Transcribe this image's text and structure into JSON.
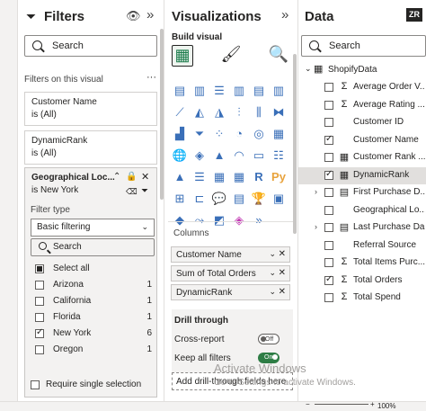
{
  "filters": {
    "title": "Filters",
    "search_placeholder": "Search",
    "section_label": "Filters on this visual",
    "cards": [
      {
        "name": "Customer Name",
        "value": "is (All)"
      },
      {
        "name": "DynamicRank",
        "value": "is (All)"
      }
    ],
    "active_card": {
      "name": "Geographical Loc...",
      "value": "is New York",
      "filter_type_label": "Filter type",
      "filter_type": "Basic filtering",
      "search_placeholder": "Search"
    },
    "items": [
      {
        "label": "Select all",
        "count": "",
        "state": "partial"
      },
      {
        "label": "Arizona",
        "count": "1",
        "state": "off"
      },
      {
        "label": "California",
        "count": "1",
        "state": "off"
      },
      {
        "label": "Florida",
        "count": "1",
        "state": "off"
      },
      {
        "label": "New York",
        "count": "6",
        "state": "on"
      },
      {
        "label": "Oregon",
        "count": "1",
        "state": "off"
      }
    ],
    "require_single": "Require single selection"
  },
  "viz": {
    "title": "Visualizations",
    "tab": "Build visual",
    "columns_label": "Columns",
    "wells": [
      "Customer Name",
      "Sum of Total Orders",
      "DynamicRank"
    ],
    "drill_label": "Drill through",
    "cross_report": "Cross-report",
    "cross_state": "Off",
    "keep_filters": "Keep all filters",
    "keep_state": "On",
    "add_drill": "Add drill-through fields here"
  },
  "data": {
    "title": "Data",
    "search_placeholder": "Search",
    "table": "ShopifyData",
    "fields": [
      {
        "name": "Average Order V...",
        "icon": "Σ",
        "checked": false,
        "expand": false,
        "hl": false
      },
      {
        "name": "Average Rating ...",
        "icon": "Σ",
        "checked": false,
        "expand": false,
        "hl": false
      },
      {
        "name": "Customer ID",
        "icon": "",
        "checked": false,
        "expand": false,
        "hl": false
      },
      {
        "name": "Customer Name",
        "icon": "",
        "checked": true,
        "expand": false,
        "hl": false
      },
      {
        "name": "Customer Rank ...",
        "icon": "▦",
        "checked": false,
        "expand": false,
        "hl": false
      },
      {
        "name": "DynamicRank",
        "icon": "▦",
        "checked": true,
        "expand": false,
        "hl": true
      },
      {
        "name": "First Purchase D...",
        "icon": "▤",
        "checked": false,
        "expand": true,
        "hl": false
      },
      {
        "name": "Geographical Lo...",
        "icon": "",
        "checked": false,
        "expand": false,
        "hl": false
      },
      {
        "name": "Last Purchase Da...",
        "icon": "▤",
        "checked": false,
        "expand": true,
        "hl": false
      },
      {
        "name": "Referral Source",
        "icon": "",
        "checked": false,
        "expand": false,
        "hl": false
      },
      {
        "name": "Total Items Purc...",
        "icon": "Σ",
        "checked": false,
        "expand": false,
        "hl": false
      },
      {
        "name": "Total Orders",
        "icon": "Σ",
        "checked": true,
        "expand": false,
        "hl": false
      },
      {
        "name": "Total Spend",
        "icon": "Σ",
        "checked": false,
        "expand": false,
        "hl": false
      }
    ]
  },
  "watermark": {
    "line1": "Activate Windows",
    "line2": "Go to Settings to activate Windows."
  },
  "status": {
    "zoom": "100%"
  }
}
